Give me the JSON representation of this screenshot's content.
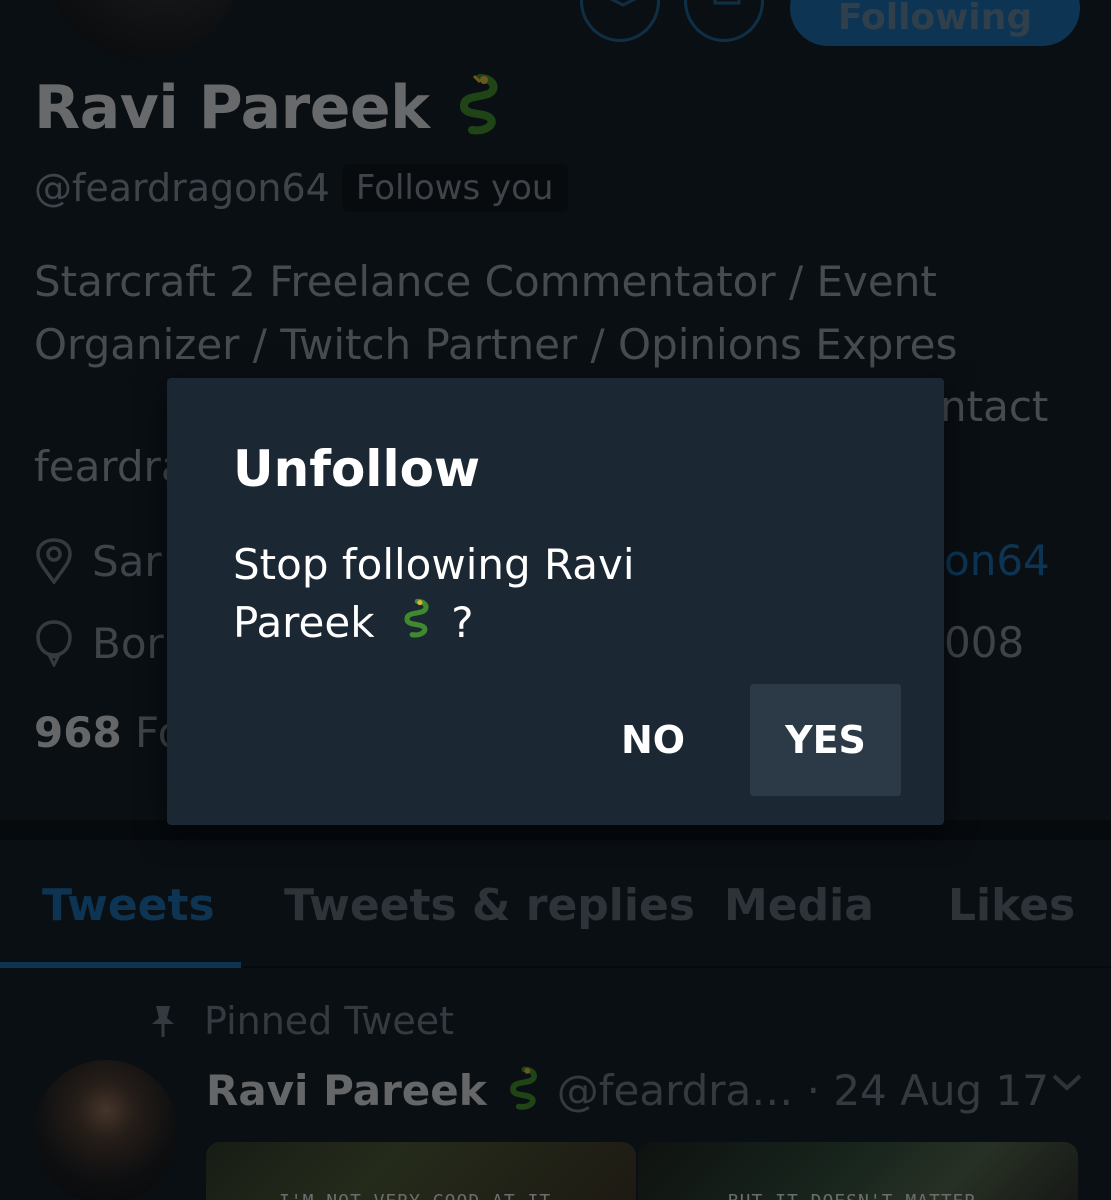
{
  "profile": {
    "name": "Ravi Pareek",
    "handle": "@feardragon64",
    "follows_you": "Follows you",
    "bio": "Starcraft 2 Freelance Commentator / Event Organizer / Twitch Partner / Opinions Expres",
    "bio_tail": "ntact",
    "bio_line4": "feardra",
    "follow_button": "Following",
    "location_fragment": "Sar",
    "link_fragment": "on64",
    "born_fragment": "Bor",
    "joined_fragment": "008",
    "followers_count": "968",
    "followers_fragment": "Fo"
  },
  "tabs": [
    "Tweets",
    "Tweets & replies",
    "Media",
    "Likes"
  ],
  "pinned": {
    "label": "Pinned Tweet",
    "name": "Ravi Pareek",
    "handle": "@feardra… · 24 Aug 17",
    "media_captions": [
      "I'M NOT VERY GOOD AT IT.",
      "BUT IT DOESN'T MATTER."
    ]
  },
  "dialog": {
    "title": "Unfollow",
    "message_line1": "Stop following Ravi",
    "message_line2": "Pareek",
    "message_suffix": "?",
    "no_label": "NO",
    "yes_label": "YES"
  },
  "colors": {
    "background": "#151e28",
    "accent": "#1a6aa6",
    "dialog": "#1b2732",
    "yes_button": "#2c3a47"
  }
}
